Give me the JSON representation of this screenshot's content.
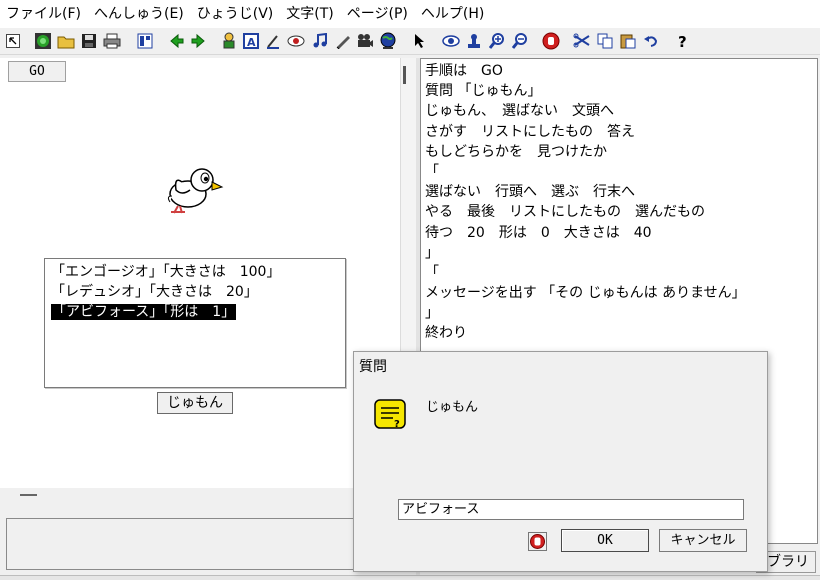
{
  "menu": [
    "ファイル(F)",
    "へんしゅう(E)",
    "ひょうじ(V)",
    "文字(T)",
    "ページ(P)",
    "ヘルプ(H)"
  ],
  "toolbar_icons": [
    "pointer-small-icon",
    "green-circle-icon",
    "open-folder-icon",
    "save-disk-icon",
    "print-icon",
    "panel-icon",
    "arrow-left-icon",
    "arrow-right-icon",
    "character-icon",
    "text-box-icon",
    "brush-icon",
    "eye-red-icon",
    "music-note-icon",
    "pen-icon",
    "movie-camera-icon",
    "globe-icon",
    "cursor-icon",
    "eye-icon",
    "stamp-icon",
    "zoom-in-icon",
    "zoom-out-icon",
    "stop-hand-icon",
    "scissors-icon",
    "copy-icon",
    "paste-icon",
    "undo-icon",
    "help-icon"
  ],
  "left": {
    "go_tab": "GO",
    "list_items": [
      "「エンゴージオ」「大きさは　100」",
      "「レデュシオ」「大きさは　20」",
      "「アビフォース」「形は　1」"
    ],
    "selected_index": 2,
    "jumon_button": "じゅもん"
  },
  "editor": {
    "lines": [
      "手順は　GO",
      "質問 「じゅもん」",
      "じゅもん、　選ばない　文頭へ",
      "さがす　リストにしたもの　答え",
      "もしどちらかを　見つけたか",
      "「",
      "選ばない　行頭へ　選ぶ　行末へ",
      "やる　最後　リストにしたもの　選んだもの",
      "待つ　20　形は　0　大きさは　40",
      "」",
      "「",
      "メッセージを出す 「その じゅもんは ありません」",
      "」",
      "終わり"
    ],
    "library_tab": "ブラリ"
  },
  "dialog": {
    "title": "質問",
    "message": "じゅもん",
    "input_value": "アビフォース",
    "ok_label": "OK",
    "cancel_label": "キャンセル"
  }
}
